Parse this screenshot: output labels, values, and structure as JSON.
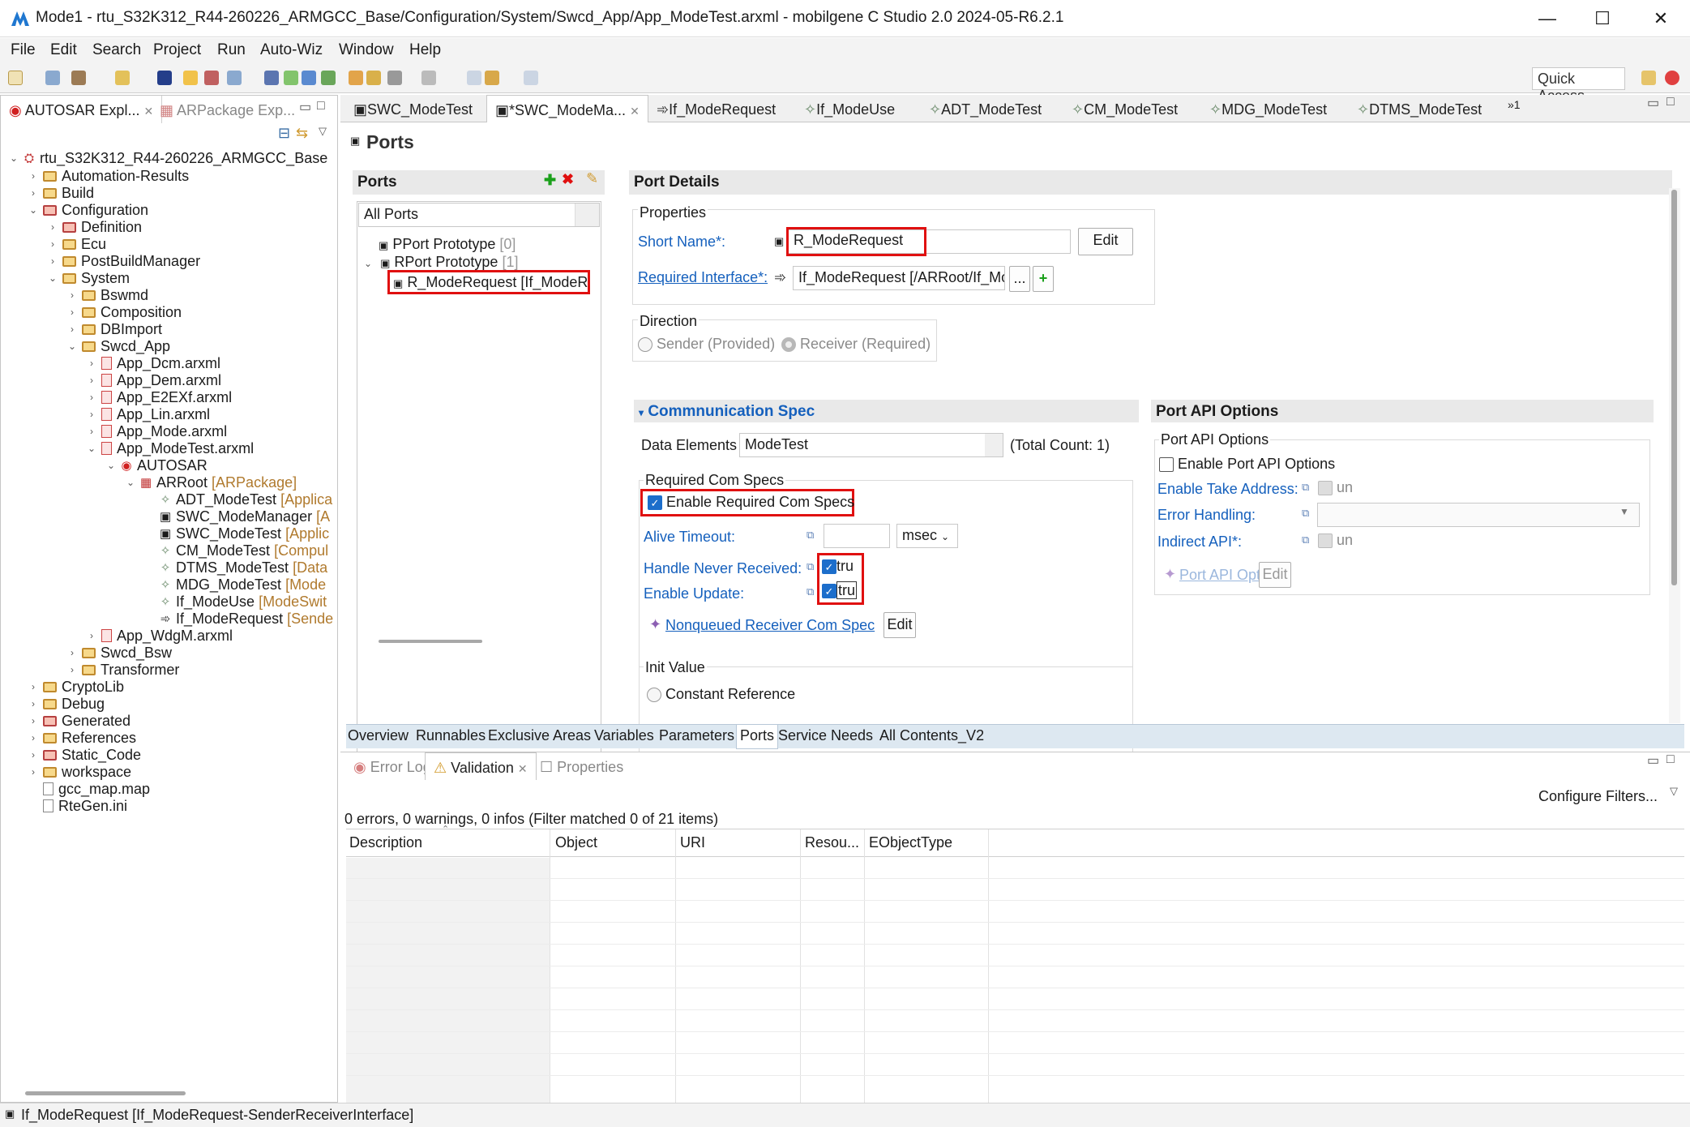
{
  "window": {
    "title": "Mode1 - rtu_S32K312_R44-260226_ARMGCC_Base/Configuration/System/Swcd_App/App_ModeTest.arxml - mobilgene C Studio 2.0 2024-05-R6.2.1",
    "minimize": "—",
    "maximize": "☐",
    "close": "✕"
  },
  "menu": [
    "File",
    "Edit",
    "Search",
    "Project",
    "Run",
    "Auto-Wiz",
    "Window",
    "Help"
  ],
  "quick_access": "Quick Access",
  "explorer": {
    "tab_active": "AUTOSAR Expl...",
    "tab_inactive": "ARPackage Exp...",
    "tree": [
      {
        "label": "rtu_S32K312_R44-260226_ARMGCC_Base",
        "extra": ""
      },
      {
        "label": "Automation-Results",
        "extra": ""
      },
      {
        "label": "Build",
        "extra": ""
      },
      {
        "label": "Configuration",
        "extra": ""
      },
      {
        "label": "Definition",
        "extra": ""
      },
      {
        "label": "Ecu",
        "extra": ""
      },
      {
        "label": "PostBuildManager",
        "extra": ""
      },
      {
        "label": "System",
        "extra": ""
      },
      {
        "label": "Bswmd",
        "extra": ""
      },
      {
        "label": "Composition",
        "extra": ""
      },
      {
        "label": "DBImport",
        "extra": ""
      },
      {
        "label": "Swcd_App",
        "extra": ""
      },
      {
        "label": "App_Dcm.arxml",
        "extra": ""
      },
      {
        "label": "App_Dem.arxml",
        "extra": ""
      },
      {
        "label": "App_E2EXf.arxml",
        "extra": ""
      },
      {
        "label": "App_Lin.arxml",
        "extra": ""
      },
      {
        "label": "App_Mode.arxml",
        "extra": ""
      },
      {
        "label": "App_ModeTest.arxml",
        "extra": ""
      },
      {
        "label": "AUTOSAR",
        "extra": ""
      },
      {
        "label": "ARRoot",
        "extra": "[ARPackage]"
      },
      {
        "label": "ADT_ModeTest",
        "extra": "[Applica"
      },
      {
        "label": "SWC_ModeManager",
        "extra": "[A"
      },
      {
        "label": "SWC_ModeTest",
        "extra": "[Applic"
      },
      {
        "label": "CM_ModeTest",
        "extra": "[Compul"
      },
      {
        "label": "DTMS_ModeTest",
        "extra": "[Data"
      },
      {
        "label": "MDG_ModeTest",
        "extra": "[Mode"
      },
      {
        "label": "If_ModeUse",
        "extra": "[ModeSwit"
      },
      {
        "label": "If_ModeRequest",
        "extra": "[Sende"
      },
      {
        "label": "App_WdgM.arxml",
        "extra": ""
      },
      {
        "label": "Swcd_Bsw",
        "extra": ""
      },
      {
        "label": "Transformer",
        "extra": ""
      },
      {
        "label": "CryptoLib",
        "extra": ""
      },
      {
        "label": "Debug",
        "extra": ""
      },
      {
        "label": "Generated",
        "extra": ""
      },
      {
        "label": "References",
        "extra": ""
      },
      {
        "label": "Static_Code",
        "extra": ""
      },
      {
        "label": "workspace",
        "extra": ""
      },
      {
        "label": "gcc_map.map",
        "extra": ""
      },
      {
        "label": "RteGen.ini",
        "extra": ""
      }
    ]
  },
  "editor_tabs": [
    "SWC_ModeTest",
    "*SWC_ModeMa...",
    "If_ModeRequest",
    "If_ModeUse",
    "ADT_ModeTest",
    "CM_ModeTest",
    "MDG_ModeTest",
    "DTMS_ModeTest"
  ],
  "editor_tabs_overflow": "»1",
  "page": {
    "title": "Ports",
    "ports": {
      "header": "Ports",
      "filter": "All Ports",
      "pport": "PPort Prototype",
      "pport_count": "[0]",
      "rport": "RPort Prototype",
      "rport_count": "[1]",
      "selected": "R_ModeRequest [If_ModeR"
    },
    "details": {
      "header": "Port Details",
      "properties_group": "Properties",
      "short_name_label": "Short Name*:",
      "short_name_value": "R_ModeRequest",
      "edit_label": "Edit",
      "req_if_label": "Required Interface*:",
      "req_if_value": "If_ModeRequest [/ARRoot/If_ModeReque",
      "browse": "...",
      "add": "+",
      "direction_group": "Direction",
      "sender": "Sender (Provided)",
      "receiver": "Receiver (Required)"
    },
    "comspec": {
      "header": "Commnunication Spec",
      "data_elements_label": "Data Elements",
      "data_elements_value": "ModeTest",
      "total_count": "(Total Count: 1)",
      "req_group": "Required Com Specs",
      "enable_req": "Enable Required Com Specs",
      "alive_timeout": "Alive Timeout:",
      "alive_value": "",
      "unit": "msec",
      "handle_never": "Handle Never Received:",
      "handle_value": "tru",
      "enable_update": "Enable Update:",
      "update_value": "tru",
      "nonqueued": "Nonqueued Receiver Com Spec",
      "nonqueued_edit": "Edit",
      "init_group": "Init Value",
      "constant_ref": "Constant Reference"
    },
    "api": {
      "header": "Port API Options",
      "group": "Port API Options",
      "enable": "Enable Port API Options",
      "take_address": "Enable Take Address:",
      "take_value": "un",
      "error_handling": "Error Handling:",
      "error_value": "",
      "indirect": "Indirect API*:",
      "indirect_value": "un",
      "api_option": "Port API Option",
      "api_edit": "Edit"
    },
    "bottom_tabs": [
      "Overview",
      "Runnables",
      "Exclusive Areas",
      "Variables",
      "Parameters",
      "Ports",
      "Service Needs",
      "All Contents_V2"
    ]
  },
  "validation": {
    "tabs": [
      "Error Log",
      "Validation",
      "Properties"
    ],
    "configure": "Configure Filters...",
    "summary": "0 errors, 0 warnings, 0 infos (Filter matched 0 of 21 items)",
    "columns": [
      "Description",
      "Object",
      "URI",
      "Resou...",
      "EObjectType"
    ]
  },
  "status": "If_ModeRequest [If_ModeRequest-SenderReceiverInterface]",
  "colors": {
    "accent": "#1c6ecb",
    "link": "#1560bd",
    "highlight": "#e01010",
    "package": "#b07a2e"
  }
}
